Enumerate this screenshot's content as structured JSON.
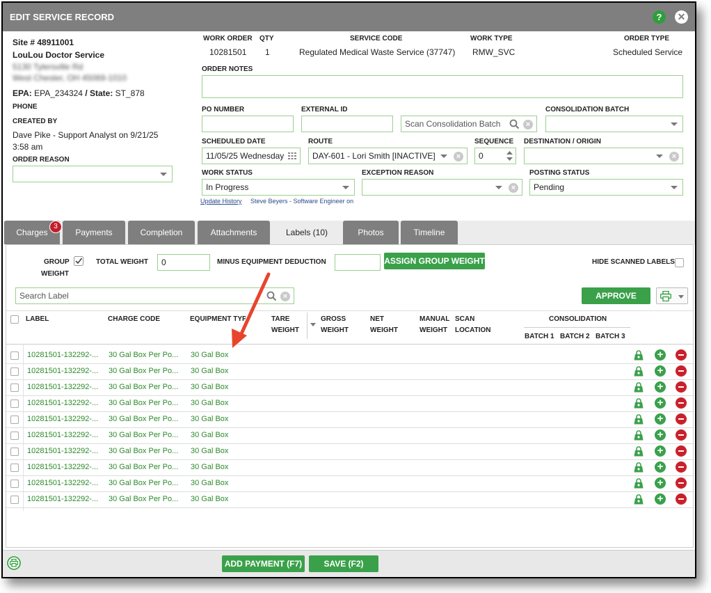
{
  "dialog": {
    "title": "EDIT SERVICE RECORD",
    "help_label": "?",
    "close_label": "✕"
  },
  "site": {
    "site_number": "Site # 48911001",
    "name": "LouLou Doctor Service",
    "address_line1": "5130 Tylersville Rd",
    "address_line2": "West Chester, OH 45069-1010",
    "epa_label": "EPA:",
    "epa_value": "EPA_234324",
    "state_label": "/ State:",
    "state_value": "ST_878",
    "phone_label": "PHONE",
    "created_by_label": "CREATED BY",
    "created_by_value": "Dave Pike - Support Analyst on 9/21/25 3:58 am",
    "order_reason_label": "ORDER REASON",
    "order_reason_value": ""
  },
  "order": {
    "work_order_label": "WORK ORDER",
    "work_order_value": "10281501",
    "qty_label": "QTY",
    "qty_value": "1",
    "service_code_label": "SERVICE CODE",
    "service_code_value": "Regulated Medical Waste Service (37747)",
    "work_type_label": "WORK TYPE",
    "work_type_value": "RMW_SVC",
    "order_type_label": "ORDER TYPE",
    "order_type_value": "Scheduled Service",
    "order_notes_label": "ORDER NOTES",
    "order_notes_value": "",
    "po_number_label": "PO NUMBER",
    "po_number_value": "",
    "external_id_label": "EXTERNAL ID",
    "external_id_value": "",
    "consolidation_search_placeholder": "Scan Consolidation Batch",
    "consolidation_batch_label": "CONSOLIDATION BATCH",
    "consolidation_batch_value": "",
    "scheduled_date_label": "SCHEDULED DATE",
    "scheduled_date_value": "11/05/25 Wednesday",
    "route_label": "ROUTE",
    "route_value": "DAY-601 - Lori Smith [INACTIVE]",
    "sequence_label": "SEQUENCE",
    "sequence_value": "0",
    "destination_label": "DESTINATION / ORIGIN",
    "destination_value": "",
    "work_status_label": "WORK STATUS",
    "work_status_value": "In Progress",
    "exception_reason_label": "EXCEPTION REASON",
    "exception_reason_value": "",
    "posting_status_label": "POSTING STATUS",
    "posting_status_value": "Pending",
    "update_history_link": "Update History",
    "updated_by": "Steve Beyers - Software Engineer on"
  },
  "tabs": [
    {
      "label": "Charges",
      "badge": "3"
    },
    {
      "label": "Payments"
    },
    {
      "label": "Completion"
    },
    {
      "label": "Attachments"
    },
    {
      "label": "Labels (10)"
    },
    {
      "label": "Photos"
    },
    {
      "label": "Timeline"
    }
  ],
  "labels_panel": {
    "group_weight_label_1": "GROUP",
    "group_weight_label_2": "WEIGHT",
    "total_weight_label": "TOTAL WEIGHT",
    "total_weight_value": "0",
    "minus_equipment_label": "MINUS EQUIPMENT DEDUCTION",
    "minus_equipment_value": "",
    "assign_button": "ASSIGN GROUP WEIGHT",
    "hide_scanned_label": "HIDE SCANNED LABELS",
    "search_placeholder": "Search Label",
    "approve_button": "APPROVE",
    "columns": {
      "label": "LABEL",
      "charge_code": "CHARGE CODE",
      "equipment_type": "EQUIPMENT TYPE",
      "tare_1": "TARE",
      "tare_2": "WEIGHT",
      "gross_1": "GROSS",
      "gross_2": "WEIGHT",
      "net_1": "NET",
      "net_2": "WEIGHT",
      "manual_1": "MANUAL",
      "manual_2": "WEIGHT",
      "scan_1": "SCAN",
      "scan_2": "LOCATION",
      "consolidation": "CONSOLIDATION",
      "batch1": "BATCH 1",
      "batch2": "BATCH 2",
      "batch3": "BATCH 3"
    },
    "rows": [
      {
        "label": "10281501-132292-...",
        "charge_code": "30 Gal Box Per Po...",
        "equipment_type": "30 Gal Box"
      },
      {
        "label": "10281501-132292-...",
        "charge_code": "30 Gal Box Per Po...",
        "equipment_type": "30 Gal Box"
      },
      {
        "label": "10281501-132292-...",
        "charge_code": "30 Gal Box Per Po...",
        "equipment_type": "30 Gal Box"
      },
      {
        "label": "10281501-132292-...",
        "charge_code": "30 Gal Box Per Po...",
        "equipment_type": "30 Gal Box"
      },
      {
        "label": "10281501-132292-...",
        "charge_code": "30 Gal Box Per Po...",
        "equipment_type": "30 Gal Box"
      },
      {
        "label": "10281501-132292-...",
        "charge_code": "30 Gal Box Per Po...",
        "equipment_type": "30 Gal Box"
      },
      {
        "label": "10281501-132292-...",
        "charge_code": "30 Gal Box Per Po...",
        "equipment_type": "30 Gal Box"
      },
      {
        "label": "10281501-132292-...",
        "charge_code": "30 Gal Box Per Po...",
        "equipment_type": "30 Gal Box"
      },
      {
        "label": "10281501-132292-...",
        "charge_code": "30 Gal Box Per Po...",
        "equipment_type": "30 Gal Box"
      },
      {
        "label": "10281501-132292-...",
        "charge_code": "30 Gal Box Per Po...",
        "equipment_type": "30 Gal Box"
      }
    ]
  },
  "footer": {
    "add_payment_button": "ADD PAYMENT (F7)",
    "save_button": "SAVE (F2)"
  },
  "colors": {
    "accent_green": "#3aa14a",
    "title_bar": "#7f7f7f",
    "annotation_arrow": "#e8442c"
  }
}
